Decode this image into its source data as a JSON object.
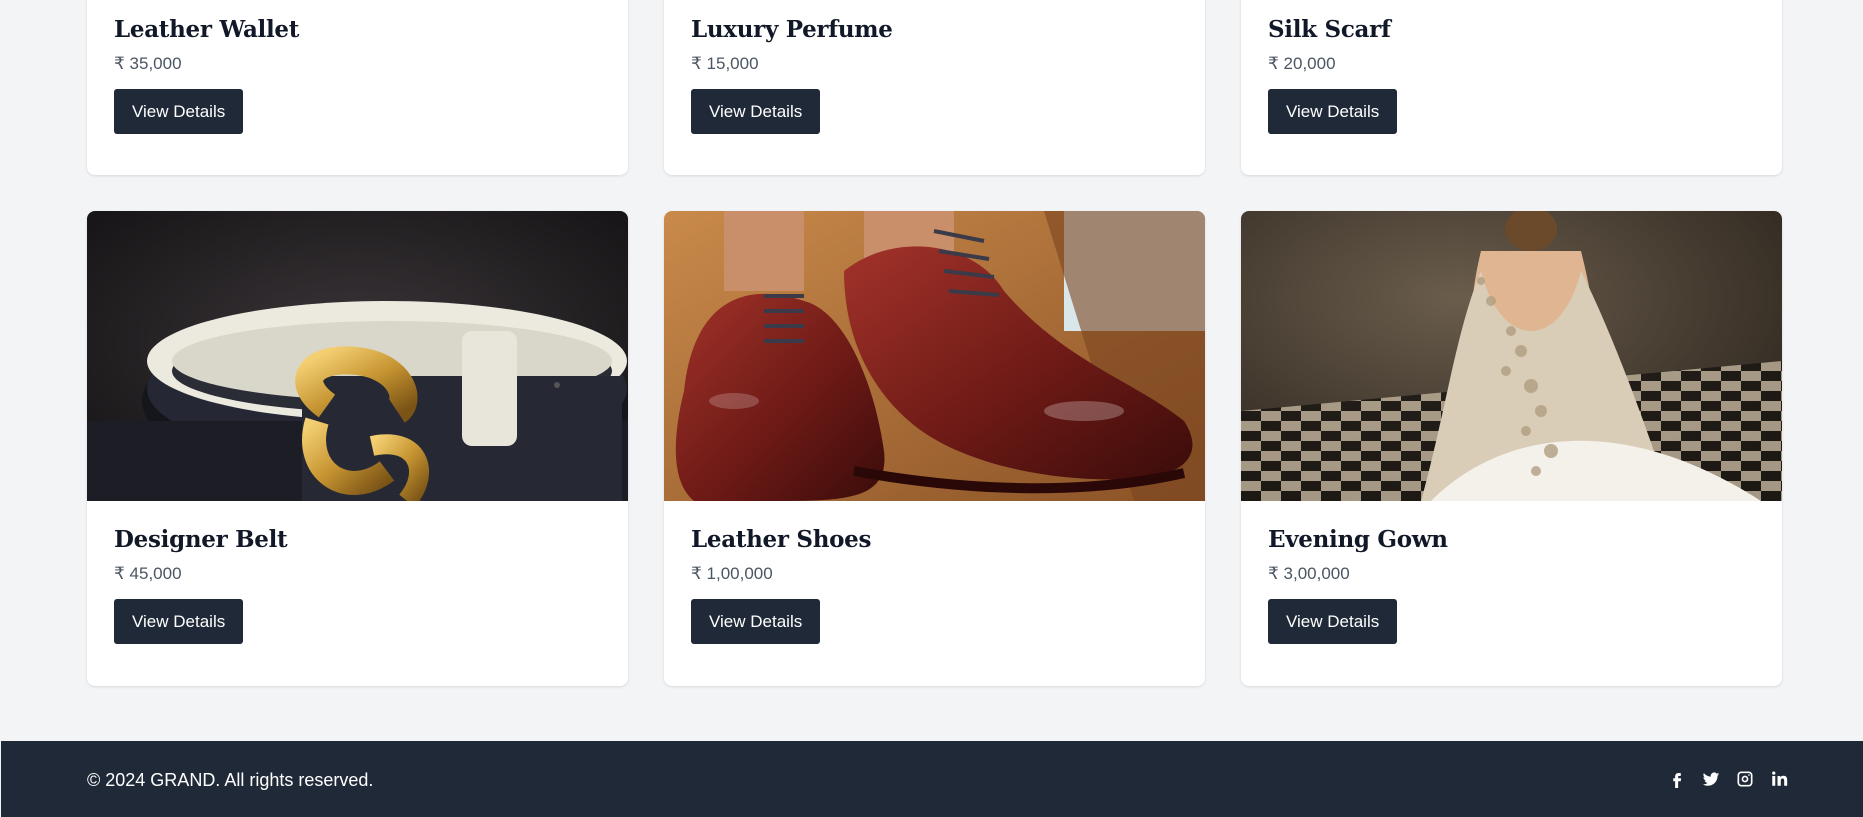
{
  "products_top": [
    {
      "name": "Leather Wallet",
      "price": "₹ 35,000",
      "button": "View Details"
    },
    {
      "name": "Luxury Perfume",
      "price": "₹ 15,000",
      "button": "View Details"
    },
    {
      "name": "Silk Scarf",
      "price": "₹ 20,000",
      "button": "View Details"
    }
  ],
  "products_bottom": [
    {
      "name": "Designer Belt",
      "price": "₹ 45,000",
      "button": "View Details",
      "image": "designer-belt-photo"
    },
    {
      "name": "Leather Shoes",
      "price": "₹ 1,00,000",
      "button": "View Details",
      "image": "leather-shoes-photo"
    },
    {
      "name": "Evening Gown",
      "price": "₹ 3,00,000",
      "button": "View Details",
      "image": "evening-gown-photo"
    }
  ],
  "footer": {
    "copyright": "© 2024 GRAND. All rights reserved.",
    "social_icons": [
      "facebook-icon",
      "twitter-icon",
      "instagram-icon",
      "linkedin-icon"
    ]
  },
  "colors": {
    "page_bg": "#f3f4f6",
    "card_bg": "#ffffff",
    "button_bg": "#1f2937",
    "footer_bg": "#1f2937",
    "price_text": "#4b5563"
  }
}
